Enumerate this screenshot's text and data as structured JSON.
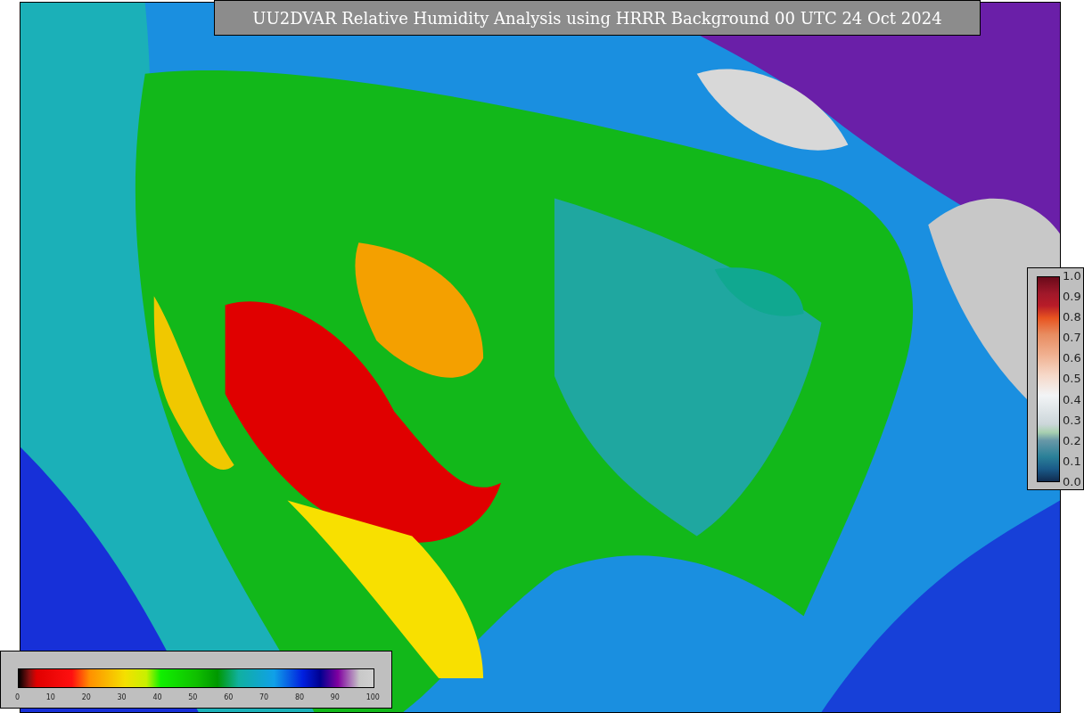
{
  "title": "UU2DVAR Relative Humidity Analysis using HRRR Background 00 UTC 24 Oct 2024",
  "increment_colorbar": {
    "ticks": [
      "1.0",
      "0.9",
      "0.8",
      "0.7",
      "0.6",
      "0.5",
      "0.4",
      "0.3",
      "0.2",
      "0.1",
      "0.0"
    ]
  },
  "humidity_colorbar": {
    "ticks": [
      "0",
      "10",
      "20",
      "30",
      "40",
      "50",
      "60",
      "70",
      "80",
      "90",
      "100"
    ]
  }
}
